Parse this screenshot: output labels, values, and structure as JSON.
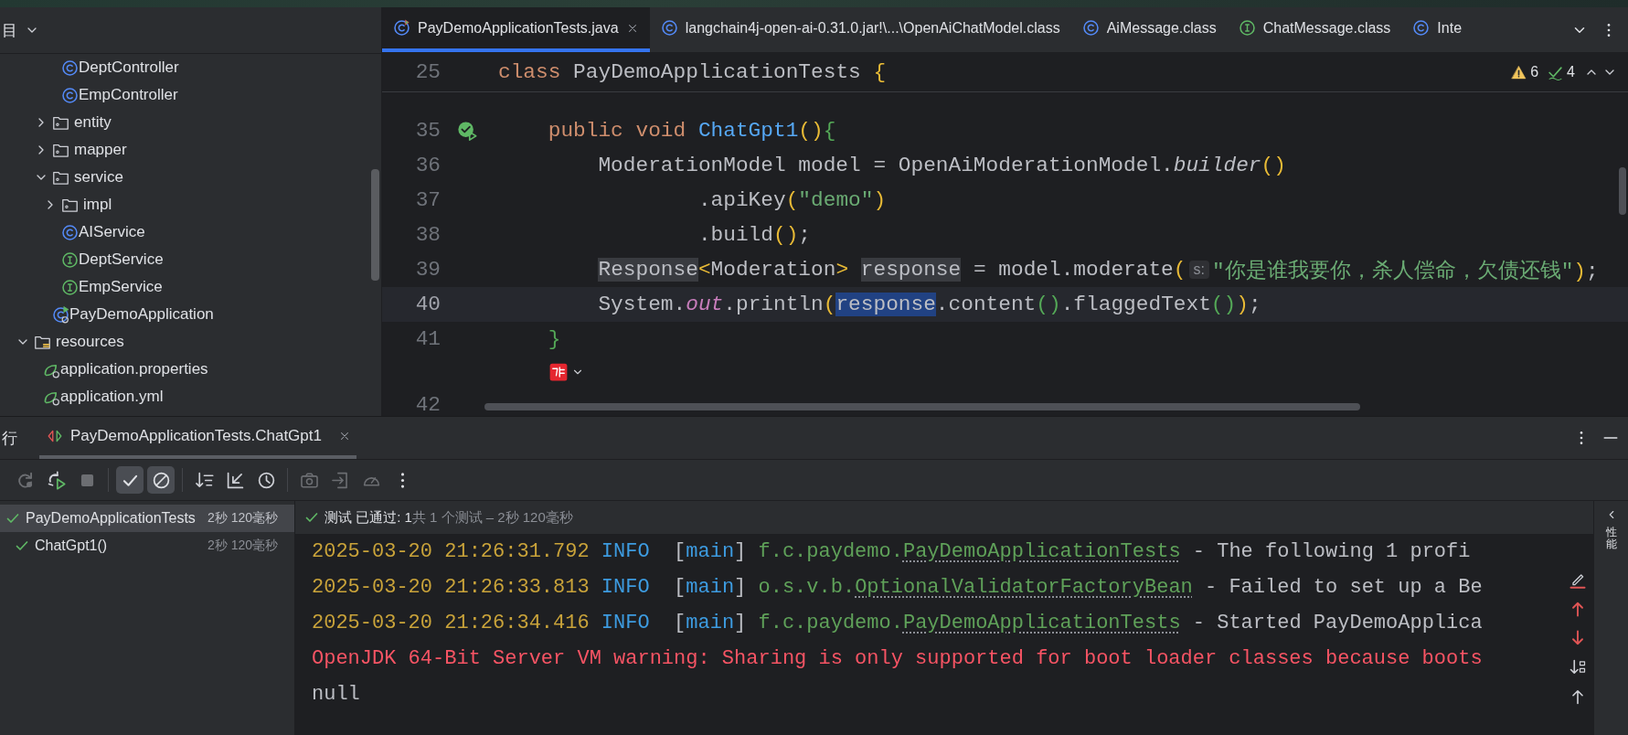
{
  "project": {
    "header": "目",
    "tree": [
      {
        "children": [
          {
            "children": [
              {
                "children": [
                  {
                    "label": "DeptController",
                    "kind": "class"
                  },
                  {
                    "label": "EmpController",
                    "kind": "class"
                  }
                ]
              },
              {
                "label": "entity",
                "kind": "package",
                "expanded": false
              },
              {
                "label": "mapper",
                "kind": "package",
                "expanded": false
              },
              {
                "label": "service",
                "kind": "package",
                "expanded": true,
                "children": [
                  {
                    "label": "impl",
                    "kind": "package",
                    "expanded": false
                  },
                  {
                    "label": "AIService",
                    "kind": "class"
                  },
                  {
                    "label": "DeptService",
                    "kind": "interface"
                  },
                  {
                    "label": "EmpService",
                    "kind": "interface"
                  }
                ]
              },
              {
                "label": "PayDemoApplication",
                "kind": "app"
              }
            ]
          }
        ]
      },
      {
        "label": "resources",
        "kind": "resources",
        "expanded": true,
        "children": [
          {
            "label": "application.properties",
            "kind": "config"
          },
          {
            "label": "application.yml",
            "kind": "config"
          }
        ]
      }
    ]
  },
  "editor": {
    "tabs": [
      {
        "label": "PayDemoApplicationTests.java",
        "kind": "test",
        "selected": true,
        "closable": true
      },
      {
        "label": "langchain4j-open-ai-0.31.0.jar!\\...\\OpenAiChatModel.class",
        "kind": "class",
        "selected": false,
        "closable": false
      },
      {
        "label": "AiMessage.class",
        "kind": "class",
        "selected": false,
        "closable": false
      },
      {
        "label": "ChatMessage.class",
        "kind": "interface",
        "selected": false,
        "closable": false
      },
      {
        "label": "Inte",
        "kind": "class",
        "selected": false,
        "closable": false
      }
    ],
    "warnings": "6",
    "checks": "4",
    "sticky": {
      "number": "25",
      "tokens": [
        {
          "kind": "keyword",
          "text": "class "
        },
        {
          "kind": "plain",
          "text": "PayDemoApplicationTests "
        },
        {
          "kind": "brace1",
          "text": "{"
        }
      ]
    },
    "lines": [
      {
        "kind": "code",
        "number": "35",
        "current": false,
        "run_marker": true,
        "tokens": [
          {
            "kind": "keyword",
            "text": "    public void "
          },
          {
            "kind": "function",
            "text": "ChatGpt1"
          },
          {
            "kind": "brace1",
            "text": "()"
          },
          {
            "kind": "brace2",
            "text": "{"
          }
        ]
      },
      {
        "kind": "code",
        "number": "36",
        "current": false,
        "tokens": [
          {
            "kind": "plain",
            "text": "        ModerationModel model = OpenAiModerationModel."
          },
          {
            "kind": "italic",
            "text": "builder"
          },
          {
            "kind": "brace1",
            "text": "()"
          }
        ]
      },
      {
        "kind": "code",
        "number": "37",
        "current": false,
        "tokens": [
          {
            "kind": "plain",
            "text": "                .apiKey"
          },
          {
            "kind": "brace1",
            "text": "("
          },
          {
            "kind": "string",
            "text": "\"demo\""
          },
          {
            "kind": "brace1",
            "text": ")"
          }
        ]
      },
      {
        "kind": "code",
        "number": "38",
        "current": false,
        "tokens": [
          {
            "kind": "plain",
            "text": "                .build"
          },
          {
            "kind": "brace1",
            "text": "()"
          },
          {
            "kind": "plain",
            "text": ";"
          }
        ]
      },
      {
        "kind": "code",
        "number": "39",
        "current": false,
        "tokens": [
          {
            "kind": "usage",
            "text": "        Response"
          },
          {
            "kind": "brace1",
            "text": "<"
          },
          {
            "kind": "plain",
            "text": "Moderation"
          },
          {
            "kind": "brace1",
            "text": "> "
          },
          {
            "kind": "usage",
            "text": "response"
          },
          {
            "kind": "plain",
            "text": " = model.moderate"
          },
          {
            "kind": "brace1",
            "text": "("
          },
          {
            "kind": "hint",
            "text": "s:"
          },
          {
            "kind": "string",
            "text": "\"你是谁我要你，杀人偿命，欠债还钱\""
          },
          {
            "kind": "brace1",
            "text": ")"
          },
          {
            "kind": "plain",
            "text": ";"
          }
        ]
      },
      {
        "kind": "code",
        "number": "40",
        "current": true,
        "tokens": [
          {
            "kind": "plain",
            "text": "        System."
          },
          {
            "kind": "field",
            "text": "out"
          },
          {
            "kind": "plain",
            "text": ".println"
          },
          {
            "kind": "brace1",
            "text": "("
          },
          {
            "kind": "selection",
            "text": "response"
          },
          {
            "kind": "plain",
            "text": ".content"
          },
          {
            "kind": "brace2",
            "text": "()"
          },
          {
            "kind": "plain",
            "text": ".flaggedText"
          },
          {
            "kind": "brace2",
            "text": "()"
          },
          {
            "kind": "brace1",
            "text": ")"
          },
          {
            "kind": "plain",
            "text": ";"
          }
        ]
      },
      {
        "kind": "code",
        "number": "41",
        "current": false,
        "tokens": [
          {
            "kind": "brace2",
            "text": "    }"
          }
        ]
      },
      {
        "kind": "inlay"
      },
      {
        "kind": "code",
        "number": "42",
        "current": false
      }
    ]
  },
  "run_panel": {
    "partial_tab": "行",
    "tabs": [
      {
        "label": "PayDemoApplicationTests.ChatGpt1",
        "selected": true
      }
    ],
    "toolbar": [
      {
        "kind": "rerun",
        "disabled": true,
        "on": false
      },
      {
        "kind": "rerun-failed",
        "disabled": false,
        "on": false
      },
      {
        "kind": "stop",
        "disabled": true,
        "on": false
      },
      {
        "kind": "sep"
      },
      {
        "kind": "passed",
        "disabled": false,
        "on": true
      },
      {
        "kind": "ignored",
        "disabled": false,
        "on": true
      },
      {
        "kind": "sep"
      },
      {
        "kind": "sort",
        "disabled": false,
        "on": false
      },
      {
        "kind": "collapse",
        "disabled": false,
        "on": false
      },
      {
        "kind": "history",
        "disabled": false,
        "on": false
      },
      {
        "kind": "sep"
      },
      {
        "kind": "camera",
        "disabled": true,
        "on": false
      },
      {
        "kind": "import",
        "disabled": true,
        "on": false
      },
      {
        "kind": "gauge",
        "disabled": true,
        "on": false
      },
      {
        "kind": "more",
        "disabled": false,
        "on": false
      }
    ],
    "tests": [
      {
        "label": "PayDemoApplicationTests",
        "time": "2秒 120毫秒",
        "passed": true,
        "selected": true,
        "children": [
          {
            "label": "ChatGpt1()",
            "time": "2秒 120毫秒",
            "passed": true,
            "selected": false
          }
        ]
      }
    ],
    "status": {
      "summary": "测试 已通过: 1",
      "detail": "共 1 个测试 – 2秒 120毫秒"
    },
    "console": [
      {
        "tokens": [
          {
            "kind": "date",
            "text": "2025-03-20 21:26:31.792 "
          },
          {
            "kind": "level",
            "text": "INFO"
          },
          {
            "kind": "plain",
            "text": "  ["
          },
          {
            "kind": "level",
            "text": "main"
          },
          {
            "kind": "plain",
            "text": "] "
          },
          {
            "kind": "logger",
            "text": "f.c.paydemo."
          },
          {
            "kind": "logger-class",
            "text": "PayDemoApplicationTests"
          },
          {
            "kind": "plain",
            "text": " - The following 1 profi"
          }
        ]
      },
      {
        "tokens": [
          {
            "kind": "date",
            "text": "2025-03-20 21:26:33.813 "
          },
          {
            "kind": "level",
            "text": "INFO"
          },
          {
            "kind": "plain",
            "text": "  ["
          },
          {
            "kind": "level",
            "text": "main"
          },
          {
            "kind": "plain",
            "text": "] "
          },
          {
            "kind": "logger",
            "text": "o.s.v.b."
          },
          {
            "kind": "logger-class",
            "text": "OptionalValidatorFactoryBean"
          },
          {
            "kind": "plain",
            "text": " - Failed to set up a Be"
          }
        ]
      },
      {
        "tokens": [
          {
            "kind": "date",
            "text": "2025-03-20 21:26:34.416 "
          },
          {
            "kind": "level",
            "text": "INFO"
          },
          {
            "kind": "plain",
            "text": "  ["
          },
          {
            "kind": "level",
            "text": "main"
          },
          {
            "kind": "plain",
            "text": "] "
          },
          {
            "kind": "logger",
            "text": "f.c.paydemo."
          },
          {
            "kind": "logger-class",
            "text": "PayDemoApplicationTests"
          },
          {
            "kind": "plain",
            "text": " - Started PayDemoApplica"
          }
        ]
      },
      {
        "tokens": [
          {
            "kind": "error",
            "text": "OpenJDK 64-Bit Server VM warning: Sharing is only supported for boot loader classes because boots"
          }
        ]
      },
      {
        "tokens": [
          {
            "kind": "plain",
            "text": "null"
          }
        ]
      }
    ],
    "console_actions": [
      {
        "kind": "soft-wrap"
      },
      {
        "kind": "prev-red"
      },
      {
        "kind": "next-red"
      },
      {
        "kind": "scroll-end"
      },
      {
        "kind": "up"
      }
    ],
    "side_tool": "性能"
  }
}
